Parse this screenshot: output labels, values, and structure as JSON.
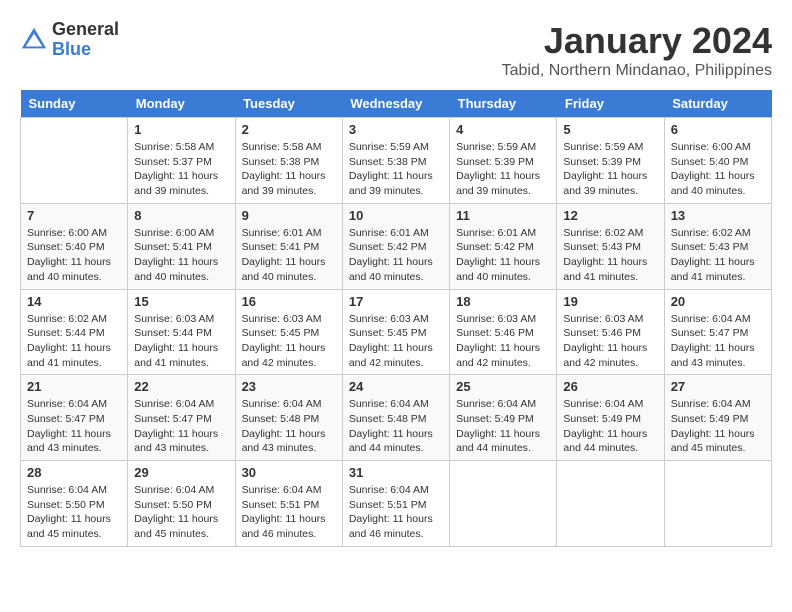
{
  "header": {
    "logo_general": "General",
    "logo_blue": "Blue",
    "title": "January 2024",
    "subtitle": "Tabid, Northern Mindanao, Philippines"
  },
  "days_of_week": [
    "Sunday",
    "Monday",
    "Tuesday",
    "Wednesday",
    "Thursday",
    "Friday",
    "Saturday"
  ],
  "weeks": [
    [
      {
        "day": "",
        "sunrise": "",
        "sunset": "",
        "daylight": ""
      },
      {
        "day": "1",
        "sunrise": "Sunrise: 5:58 AM",
        "sunset": "Sunset: 5:37 PM",
        "daylight": "Daylight: 11 hours and 39 minutes."
      },
      {
        "day": "2",
        "sunrise": "Sunrise: 5:58 AM",
        "sunset": "Sunset: 5:38 PM",
        "daylight": "Daylight: 11 hours and 39 minutes."
      },
      {
        "day": "3",
        "sunrise": "Sunrise: 5:59 AM",
        "sunset": "Sunset: 5:38 PM",
        "daylight": "Daylight: 11 hours and 39 minutes."
      },
      {
        "day": "4",
        "sunrise": "Sunrise: 5:59 AM",
        "sunset": "Sunset: 5:39 PM",
        "daylight": "Daylight: 11 hours and 39 minutes."
      },
      {
        "day": "5",
        "sunrise": "Sunrise: 5:59 AM",
        "sunset": "Sunset: 5:39 PM",
        "daylight": "Daylight: 11 hours and 39 minutes."
      },
      {
        "day": "6",
        "sunrise": "Sunrise: 6:00 AM",
        "sunset": "Sunset: 5:40 PM",
        "daylight": "Daylight: 11 hours and 40 minutes."
      }
    ],
    [
      {
        "day": "7",
        "sunrise": "Sunrise: 6:00 AM",
        "sunset": "Sunset: 5:40 PM",
        "daylight": "Daylight: 11 hours and 40 minutes."
      },
      {
        "day": "8",
        "sunrise": "Sunrise: 6:00 AM",
        "sunset": "Sunset: 5:41 PM",
        "daylight": "Daylight: 11 hours and 40 minutes."
      },
      {
        "day": "9",
        "sunrise": "Sunrise: 6:01 AM",
        "sunset": "Sunset: 5:41 PM",
        "daylight": "Daylight: 11 hours and 40 minutes."
      },
      {
        "day": "10",
        "sunrise": "Sunrise: 6:01 AM",
        "sunset": "Sunset: 5:42 PM",
        "daylight": "Daylight: 11 hours and 40 minutes."
      },
      {
        "day": "11",
        "sunrise": "Sunrise: 6:01 AM",
        "sunset": "Sunset: 5:42 PM",
        "daylight": "Daylight: 11 hours and 40 minutes."
      },
      {
        "day": "12",
        "sunrise": "Sunrise: 6:02 AM",
        "sunset": "Sunset: 5:43 PM",
        "daylight": "Daylight: 11 hours and 41 minutes."
      },
      {
        "day": "13",
        "sunrise": "Sunrise: 6:02 AM",
        "sunset": "Sunset: 5:43 PM",
        "daylight": "Daylight: 11 hours and 41 minutes."
      }
    ],
    [
      {
        "day": "14",
        "sunrise": "Sunrise: 6:02 AM",
        "sunset": "Sunset: 5:44 PM",
        "daylight": "Daylight: 11 hours and 41 minutes."
      },
      {
        "day": "15",
        "sunrise": "Sunrise: 6:03 AM",
        "sunset": "Sunset: 5:44 PM",
        "daylight": "Daylight: 11 hours and 41 minutes."
      },
      {
        "day": "16",
        "sunrise": "Sunrise: 6:03 AM",
        "sunset": "Sunset: 5:45 PM",
        "daylight": "Daylight: 11 hours and 42 minutes."
      },
      {
        "day": "17",
        "sunrise": "Sunrise: 6:03 AM",
        "sunset": "Sunset: 5:45 PM",
        "daylight": "Daylight: 11 hours and 42 minutes."
      },
      {
        "day": "18",
        "sunrise": "Sunrise: 6:03 AM",
        "sunset": "Sunset: 5:46 PM",
        "daylight": "Daylight: 11 hours and 42 minutes."
      },
      {
        "day": "19",
        "sunrise": "Sunrise: 6:03 AM",
        "sunset": "Sunset: 5:46 PM",
        "daylight": "Daylight: 11 hours and 42 minutes."
      },
      {
        "day": "20",
        "sunrise": "Sunrise: 6:04 AM",
        "sunset": "Sunset: 5:47 PM",
        "daylight": "Daylight: 11 hours and 43 minutes."
      }
    ],
    [
      {
        "day": "21",
        "sunrise": "Sunrise: 6:04 AM",
        "sunset": "Sunset: 5:47 PM",
        "daylight": "Daylight: 11 hours and 43 minutes."
      },
      {
        "day": "22",
        "sunrise": "Sunrise: 6:04 AM",
        "sunset": "Sunset: 5:47 PM",
        "daylight": "Daylight: 11 hours and 43 minutes."
      },
      {
        "day": "23",
        "sunrise": "Sunrise: 6:04 AM",
        "sunset": "Sunset: 5:48 PM",
        "daylight": "Daylight: 11 hours and 43 minutes."
      },
      {
        "day": "24",
        "sunrise": "Sunrise: 6:04 AM",
        "sunset": "Sunset: 5:48 PM",
        "daylight": "Daylight: 11 hours and 44 minutes."
      },
      {
        "day": "25",
        "sunrise": "Sunrise: 6:04 AM",
        "sunset": "Sunset: 5:49 PM",
        "daylight": "Daylight: 11 hours and 44 minutes."
      },
      {
        "day": "26",
        "sunrise": "Sunrise: 6:04 AM",
        "sunset": "Sunset: 5:49 PM",
        "daylight": "Daylight: 11 hours and 44 minutes."
      },
      {
        "day": "27",
        "sunrise": "Sunrise: 6:04 AM",
        "sunset": "Sunset: 5:49 PM",
        "daylight": "Daylight: 11 hours and 45 minutes."
      }
    ],
    [
      {
        "day": "28",
        "sunrise": "Sunrise: 6:04 AM",
        "sunset": "Sunset: 5:50 PM",
        "daylight": "Daylight: 11 hours and 45 minutes."
      },
      {
        "day": "29",
        "sunrise": "Sunrise: 6:04 AM",
        "sunset": "Sunset: 5:50 PM",
        "daylight": "Daylight: 11 hours and 45 minutes."
      },
      {
        "day": "30",
        "sunrise": "Sunrise: 6:04 AM",
        "sunset": "Sunset: 5:51 PM",
        "daylight": "Daylight: 11 hours and 46 minutes."
      },
      {
        "day": "31",
        "sunrise": "Sunrise: 6:04 AM",
        "sunset": "Sunset: 5:51 PM",
        "daylight": "Daylight: 11 hours and 46 minutes."
      },
      {
        "day": "",
        "sunrise": "",
        "sunset": "",
        "daylight": ""
      },
      {
        "day": "",
        "sunrise": "",
        "sunset": "",
        "daylight": ""
      },
      {
        "day": "",
        "sunrise": "",
        "sunset": "",
        "daylight": ""
      }
    ]
  ]
}
